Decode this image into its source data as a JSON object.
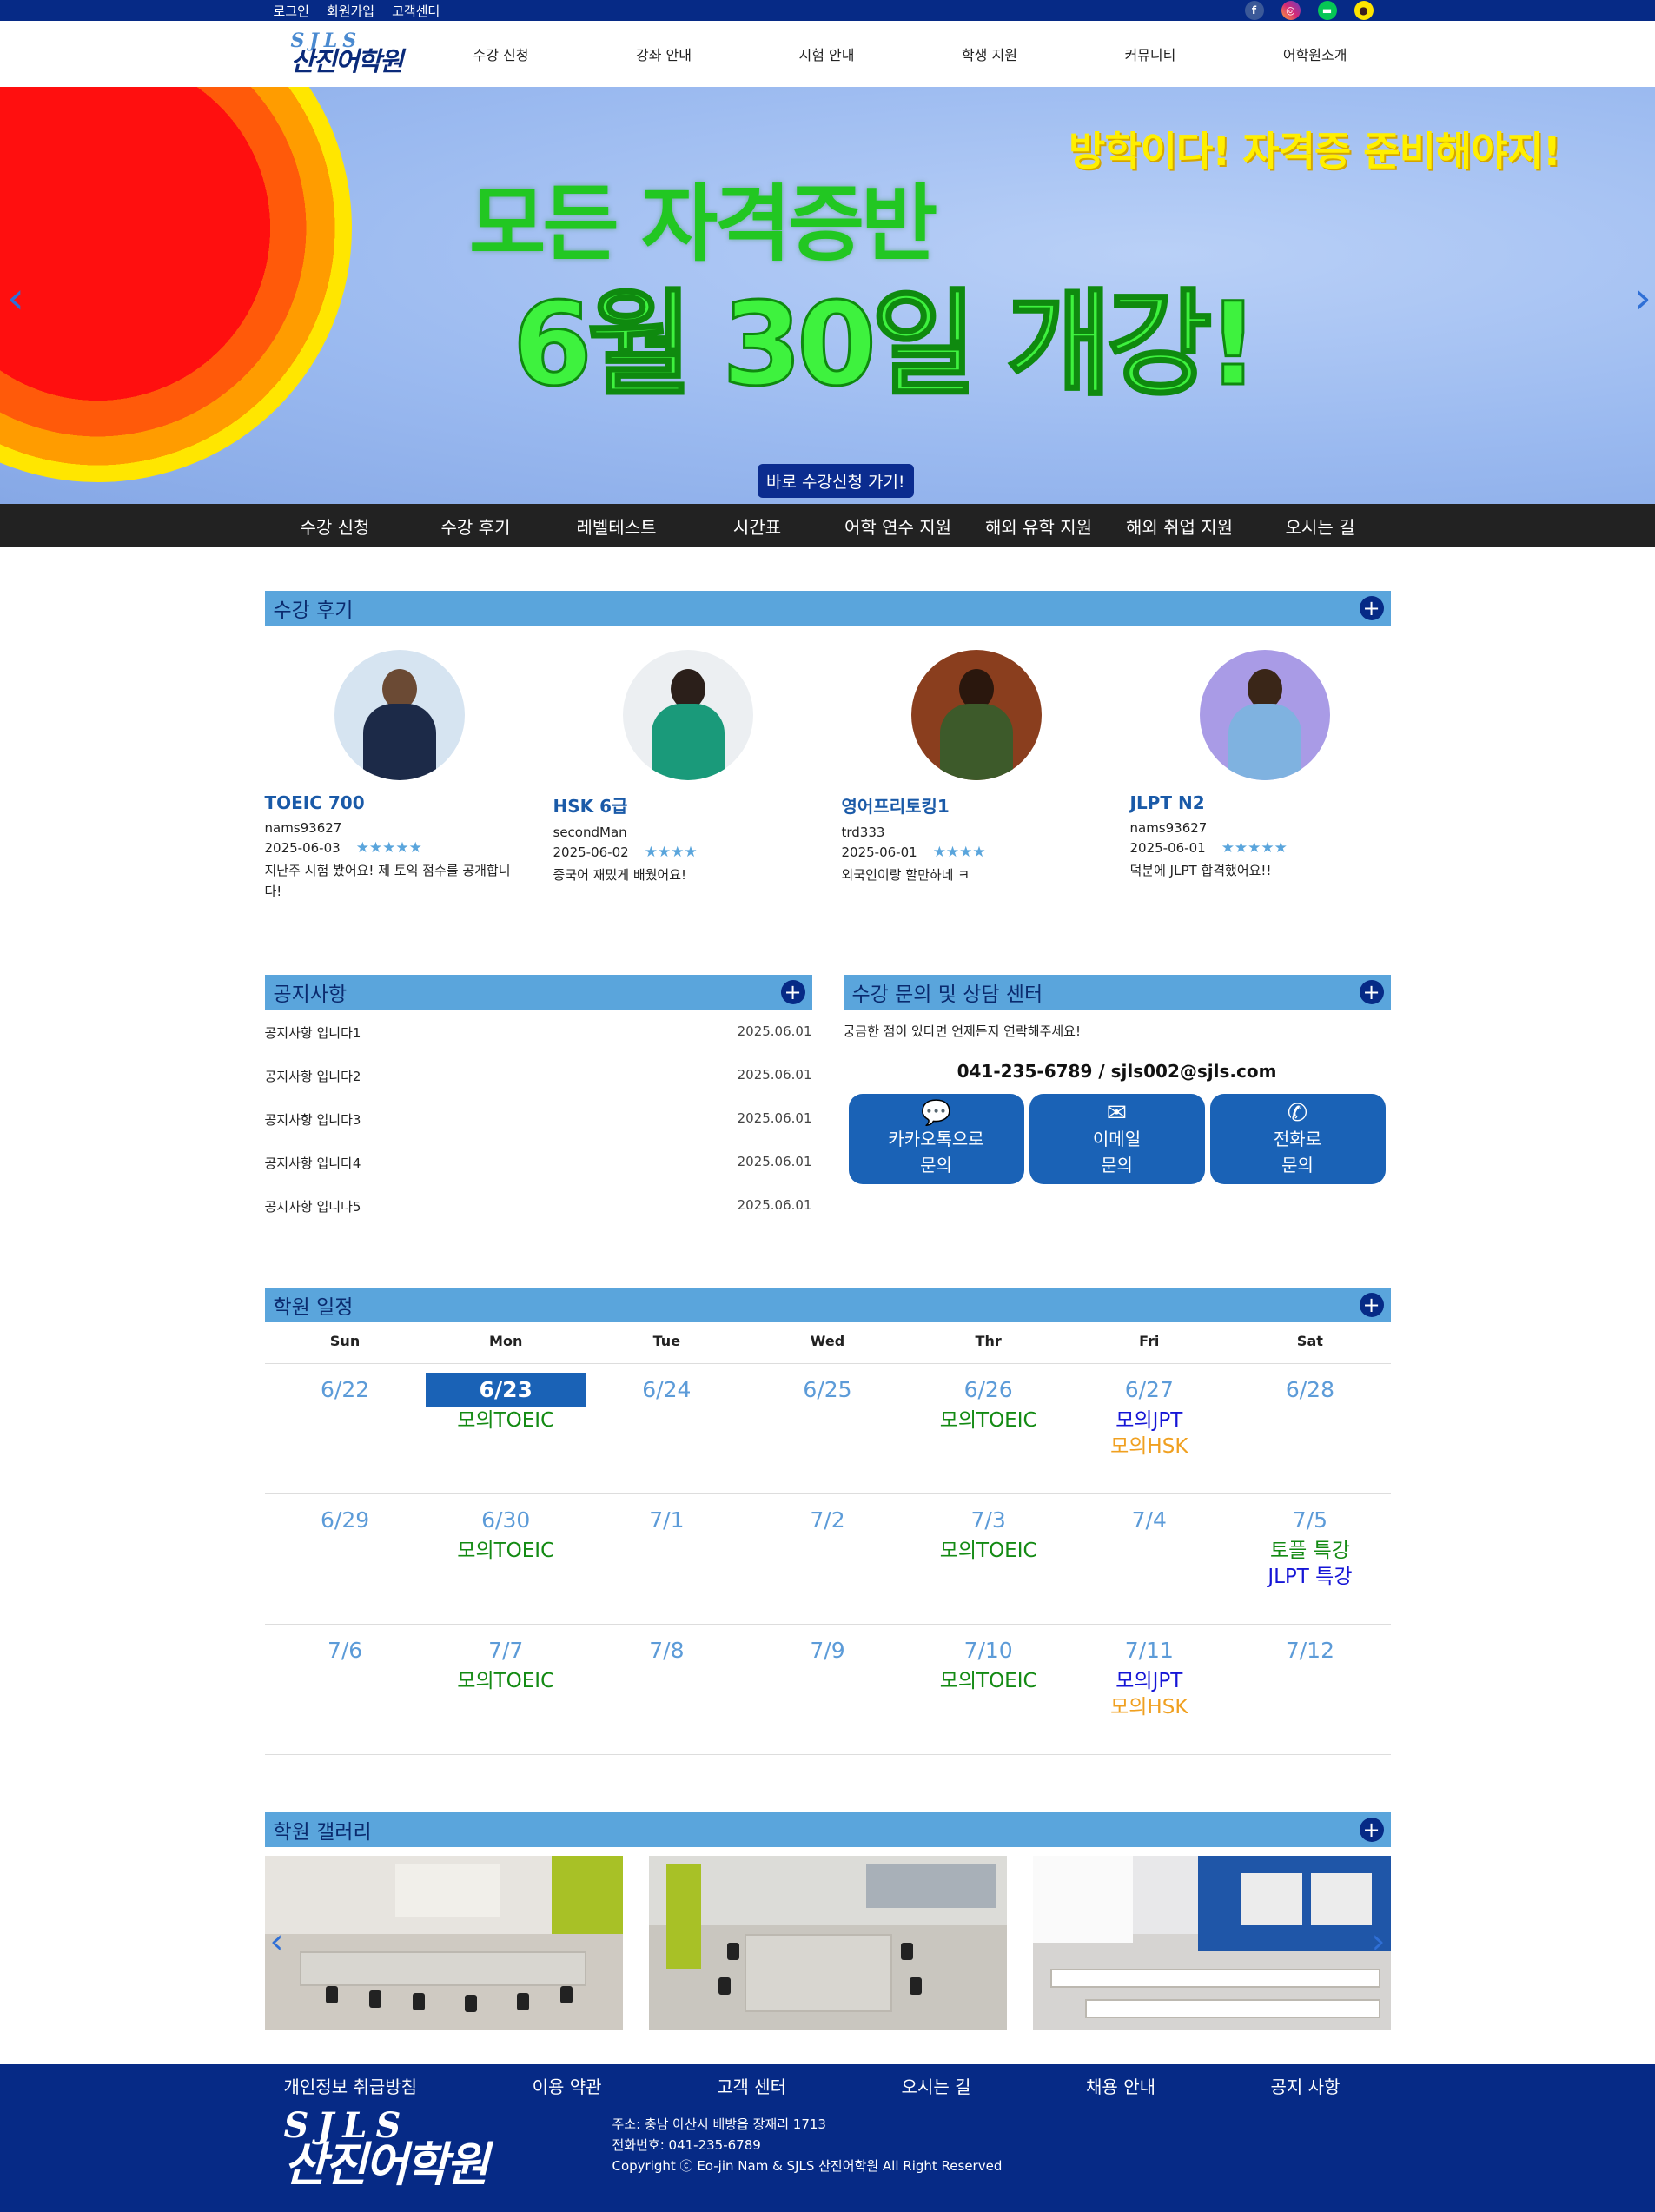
{
  "topbar": {
    "links": [
      "로그인",
      "회원가입",
      "고객센터"
    ],
    "socials": [
      "facebook-icon",
      "instagram-icon",
      "line-icon",
      "kakaotalk-icon"
    ]
  },
  "header": {
    "logo_en": "SJLS",
    "logo_ko": "산진어학원",
    "nav": [
      "수강 신청",
      "강좌 안내",
      "시험 안내",
      "학생 지원",
      "커뮤니티",
      "어학원소개"
    ]
  },
  "hero": {
    "subtitle": "방학이다! 자격증 준비해야지!",
    "line1": "모든 자격증반",
    "line2": "6월 30일 개강!",
    "button": "바로 수강신청 가기!"
  },
  "subnav": [
    "수강 신청",
    "수강 후기",
    "레벨테스트",
    "시간표",
    "어학 연수 지원",
    "해외 유학 지원",
    "해외 취업 지원",
    "오시는 길"
  ],
  "reviews": {
    "title": "수강 후기",
    "items": [
      {
        "course": "TOEIC 700",
        "user": "nams93627",
        "date": "2025-06-03",
        "stars": 5,
        "stars_text": "★★★★★",
        "text": "지난주 시험 봤어요! 제 토익 점수를 공개합니다!"
      },
      {
        "course": "HSK 6급",
        "user": "secondMan",
        "date": "2025-06-02",
        "stars": 4,
        "stars_text": "★★★★",
        "text": "중국어 재밌게 배웠어요!"
      },
      {
        "course": "영어프리토킹1",
        "user": "trd333",
        "date": "2025-06-01",
        "stars": 4,
        "stars_text": "★★★★",
        "text": "외국인이랑 할만하네 ㅋ"
      },
      {
        "course": "JLPT N2",
        "user": "nams93627",
        "date": "2025-06-01",
        "stars": 5,
        "stars_text": "★★★★★",
        "text": "덕분에 JLPT 합격했어요!!"
      }
    ]
  },
  "notice": {
    "title": "공지사항",
    "items": [
      {
        "title": "공지사항 입니다1",
        "date": "2025.06.01"
      },
      {
        "title": "공지사항 입니다2",
        "date": "2025.06.01"
      },
      {
        "title": "공지사항 입니다3",
        "date": "2025.06.01"
      },
      {
        "title": "공지사항 입니다4",
        "date": "2025.06.01"
      },
      {
        "title": "공지사항 입니다5",
        "date": "2025.06.01"
      }
    ]
  },
  "contact": {
    "title": "수강 문의 및 상담 센터",
    "desc": "궁금한 점이 있다면 언제든지 연락해주세요!",
    "info": "041-235-6789 / sjls002@sjls.com",
    "buttons": [
      {
        "icon": "chat-icon",
        "line1": "카카오톡으로",
        "line2": "문의"
      },
      {
        "icon": "envelope-icon",
        "line1": "이메일",
        "line2": "문의"
      },
      {
        "icon": "phone-icon",
        "line1": "전화로",
        "line2": "문의"
      }
    ]
  },
  "calendar": {
    "title": "학원 일정",
    "weekdays": [
      "Sun",
      "Mon",
      "Tue",
      "Wed",
      "Thr",
      "Fri",
      "Sat"
    ],
    "weeks": [
      [
        {
          "date": "6/22",
          "events": []
        },
        {
          "date": "6/23",
          "today": true,
          "events": [
            {
              "t": "모의TOEIC",
              "c": "g"
            }
          ]
        },
        {
          "date": "6/24",
          "events": []
        },
        {
          "date": "6/25",
          "events": []
        },
        {
          "date": "6/26",
          "events": [
            {
              "t": "모의TOEIC",
              "c": "g"
            }
          ]
        },
        {
          "date": "6/27",
          "events": [
            {
              "t": "모의JPT",
              "c": "b"
            },
            {
              "t": "모의HSK",
              "c": "o"
            }
          ]
        },
        {
          "date": "6/28",
          "events": []
        }
      ],
      [
        {
          "date": "6/29",
          "events": []
        },
        {
          "date": "6/30",
          "events": [
            {
              "t": "모의TOEIC",
              "c": "g"
            }
          ]
        },
        {
          "date": "7/1",
          "events": []
        },
        {
          "date": "7/2",
          "events": []
        },
        {
          "date": "7/3",
          "events": [
            {
              "t": "모의TOEIC",
              "c": "g"
            }
          ]
        },
        {
          "date": "7/4",
          "events": []
        },
        {
          "date": "7/5",
          "events": [
            {
              "t": "토플 특강",
              "c": "g"
            },
            {
              "t": "JLPT 특강",
              "c": "b"
            }
          ]
        }
      ],
      [
        {
          "date": "7/6",
          "events": []
        },
        {
          "date": "7/7",
          "events": [
            {
              "t": "모의TOEIC",
              "c": "g"
            }
          ]
        },
        {
          "date": "7/8",
          "events": []
        },
        {
          "date": "7/9",
          "events": []
        },
        {
          "date": "7/10",
          "events": [
            {
              "t": "모의TOEIC",
              "c": "g"
            }
          ]
        },
        {
          "date": "7/11",
          "events": [
            {
              "t": "모의JPT",
              "c": "b"
            },
            {
              "t": "모의HSK",
              "c": "o"
            }
          ]
        },
        {
          "date": "7/12",
          "events": []
        }
      ]
    ]
  },
  "gallery": {
    "title": "학원 갤러리"
  },
  "footer": {
    "links": [
      "개인정보 취급방침",
      "이용 약관",
      "고객 센터",
      "오시는 길",
      "채용 안내",
      "공지 사항"
    ],
    "logo_en": "SJLS",
    "logo_ko": "산진어학원",
    "address": "주소: 충남 아산시 배방읍 장재리 1713",
    "phone": "전화번호: 041-235-6789",
    "copyright": "Copyright ⓒ Eo-jin Nam & SJLS 산진어학원 All Right Reserved"
  },
  "colors": {
    "brand_navy": "#062a86",
    "section_bar": "#5aa5dc",
    "button_blue": "#1a62b6"
  }
}
